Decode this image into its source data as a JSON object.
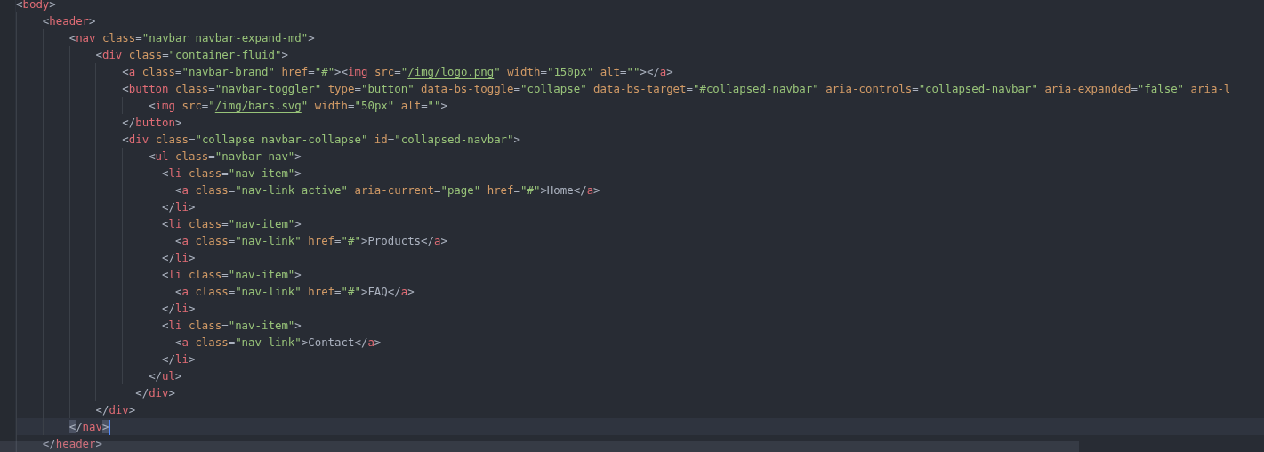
{
  "editor": {
    "lines": [
      {
        "text": "<body>",
        "current": false
      },
      {
        "text": "    <header>",
        "current": false
      },
      {
        "text": "        <nav class=\"navbar navbar-expand-md\">",
        "current": false
      },
      {
        "text": "            <div class=\"container-fluid\">",
        "current": false
      },
      {
        "text": "                <a class=\"navbar-brand\" href=\"#\"><img src=\"/img/logo.png\" width=\"150px\" alt=\"\"></a>",
        "current": false
      },
      {
        "text": "                <button class=\"navbar-toggler\" type=\"button\" data-bs-toggle=\"collapse\" data-bs-target=\"#collapsed-navbar\" aria-controls=\"collapsed-navbar\" aria-expanded=\"false\" aria-l",
        "current": false
      },
      {
        "text": "                    <img src=\"/img/bars.svg\" width=\"50px\" alt=\"\">",
        "current": false
      },
      {
        "text": "                </button>",
        "current": false
      },
      {
        "text": "                <div class=\"collapse navbar-collapse\" id=\"collapsed-navbar\">",
        "current": false
      },
      {
        "text": "                    <ul class=\"navbar-nav\">",
        "current": false
      },
      {
        "text": "                      <li class=\"nav-item\">",
        "current": false
      },
      {
        "text": "                        <a class=\"nav-link active\" aria-current=\"page\" href=\"#\">Home</a>",
        "current": false
      },
      {
        "text": "                      </li>",
        "current": false
      },
      {
        "text": "                      <li class=\"nav-item\">",
        "current": false
      },
      {
        "text": "                        <a class=\"nav-link\" href=\"#\">Products</a>",
        "current": false
      },
      {
        "text": "                      </li>",
        "current": false
      },
      {
        "text": "                      <li class=\"nav-item\">",
        "current": false
      },
      {
        "text": "                        <a class=\"nav-link\" href=\"#\">FAQ</a>",
        "current": false
      },
      {
        "text": "                      </li>",
        "current": false
      },
      {
        "text": "                      <li class=\"nav-item\">",
        "current": false
      },
      {
        "text": "                        <a class=\"nav-link\">Contact</a>",
        "current": false
      },
      {
        "text": "                      </li>",
        "current": false
      },
      {
        "text": "                    </ul>",
        "current": false
      },
      {
        "text": "                  </div>",
        "current": false
      },
      {
        "text": "            </div>",
        "current": false
      },
      {
        "text": "        </nav>",
        "current": true
      },
      {
        "text": "    </header>",
        "current": false
      }
    ]
  }
}
